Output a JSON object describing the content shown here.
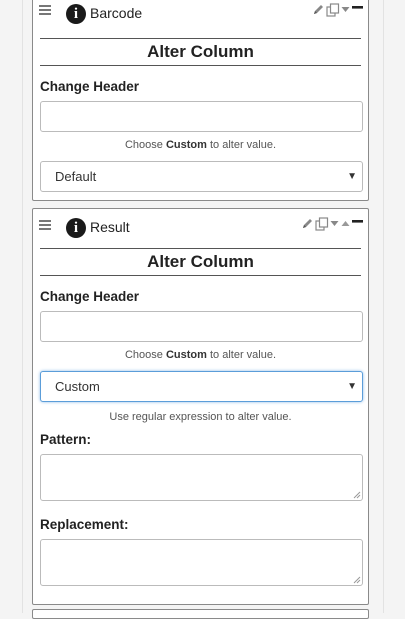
{
  "panels": [
    {
      "title": "Barcode",
      "section_title": "Alter Column",
      "change_header_label": "Change Header",
      "change_header_value": "",
      "hint_prefix": "Choose ",
      "hint_bold": "Custom",
      "hint_suffix": " to alter value.",
      "select_value": "Default"
    },
    {
      "title": "Result",
      "section_title": "Alter Column",
      "change_header_label": "Change Header",
      "change_header_value": "",
      "hint_prefix": "Choose ",
      "hint_bold": "Custom",
      "hint_suffix": " to alter value.",
      "select_value": "Custom",
      "regex_hint": "Use regular expression to alter value.",
      "pattern_label": "Pattern:",
      "pattern_value": "",
      "replacement_label": "Replacement:",
      "replacement_value": ""
    }
  ],
  "icons": [
    "menu-icon",
    "info-icon",
    "edit-icon",
    "copy-icon",
    "move-down-icon",
    "move-up-icon",
    "collapse-icon"
  ]
}
